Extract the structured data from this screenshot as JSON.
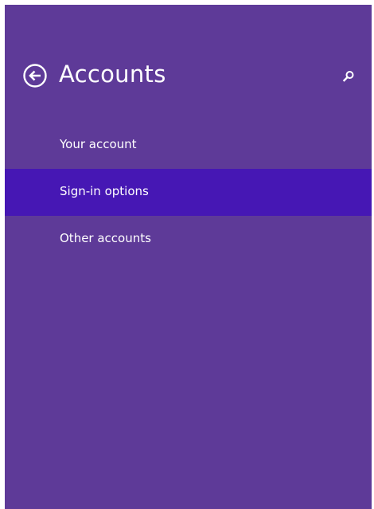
{
  "header": {
    "title": "Accounts",
    "back_icon": "back-arrow-circle-icon",
    "search_icon": "search-icon"
  },
  "nav": {
    "items": [
      {
        "label": "Your account",
        "selected": false
      },
      {
        "label": "Sign-in options",
        "selected": true
      },
      {
        "label": "Other accounts",
        "selected": false
      }
    ]
  },
  "colors": {
    "pane_background": "#5e3a98",
    "selected_background": "#4617b4",
    "text": "#ffffff"
  }
}
